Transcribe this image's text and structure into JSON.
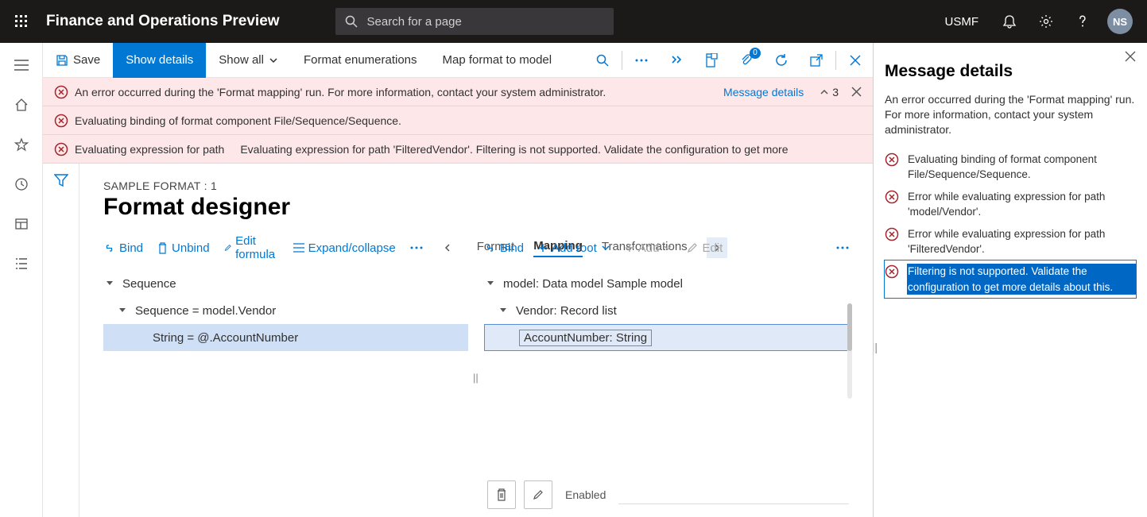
{
  "topbar": {
    "title": "Finance and Operations Preview",
    "searchPlaceholder": "Search for a page",
    "company": "USMF",
    "avatar": "NS"
  },
  "toolbar": {
    "save": "Save",
    "showDetails": "Show details",
    "showAll": "Show all",
    "formatEnum": "Format enumerations",
    "mapFormat": "Map format to model",
    "attachBadge": "0"
  },
  "errors": {
    "e1": "An error occurred during the 'Format mapping' run. For more information, contact your system administrator.",
    "e1link": "Message details",
    "e1count": "3",
    "e2": "Evaluating binding of format component File/Sequence/Sequence.",
    "e3a": "Evaluating expression for path",
    "e3b": "Evaluating expression for path 'FilteredVendor'. Filtering is not supported. Validate the configuration to get more"
  },
  "designer": {
    "breadcrumb": "SAMPLE FORMAT : 1",
    "title": "Format designer",
    "left": {
      "bind": "Bind",
      "unbind": "Unbind",
      "edit": "Edit formula",
      "expand": "Expand/collapse",
      "tabs": {
        "format": "Format",
        "mapping": "Mapping",
        "transformations": "Transformations"
      },
      "tree": {
        "n1": "Sequence",
        "n2": "Sequence = model.Vendor",
        "n3": "String = @.AccountNumber"
      }
    },
    "right": {
      "bind": "Bind",
      "addRoot": "Add root",
      "add": "Add",
      "edit": "Edit",
      "tree": {
        "n1": "model: Data model Sample model",
        "n2": "Vendor: Record list",
        "n3": "AccountNumber: String"
      },
      "enabled": "Enabled"
    }
  },
  "sidepanel": {
    "title": "Message details",
    "desc": "An error occurred during the 'Format mapping' run. For more information, contact your system administrator.",
    "items": {
      "i1": "Evaluating binding of format component File/Sequence/Sequence.",
      "i2": "Error while evaluating expression for path 'model/Vendor'.",
      "i3": "Error while evaluating expression for path 'FilteredVendor'.",
      "i4": "Filtering is not supported. Validate the configuration to get more details about this."
    }
  }
}
